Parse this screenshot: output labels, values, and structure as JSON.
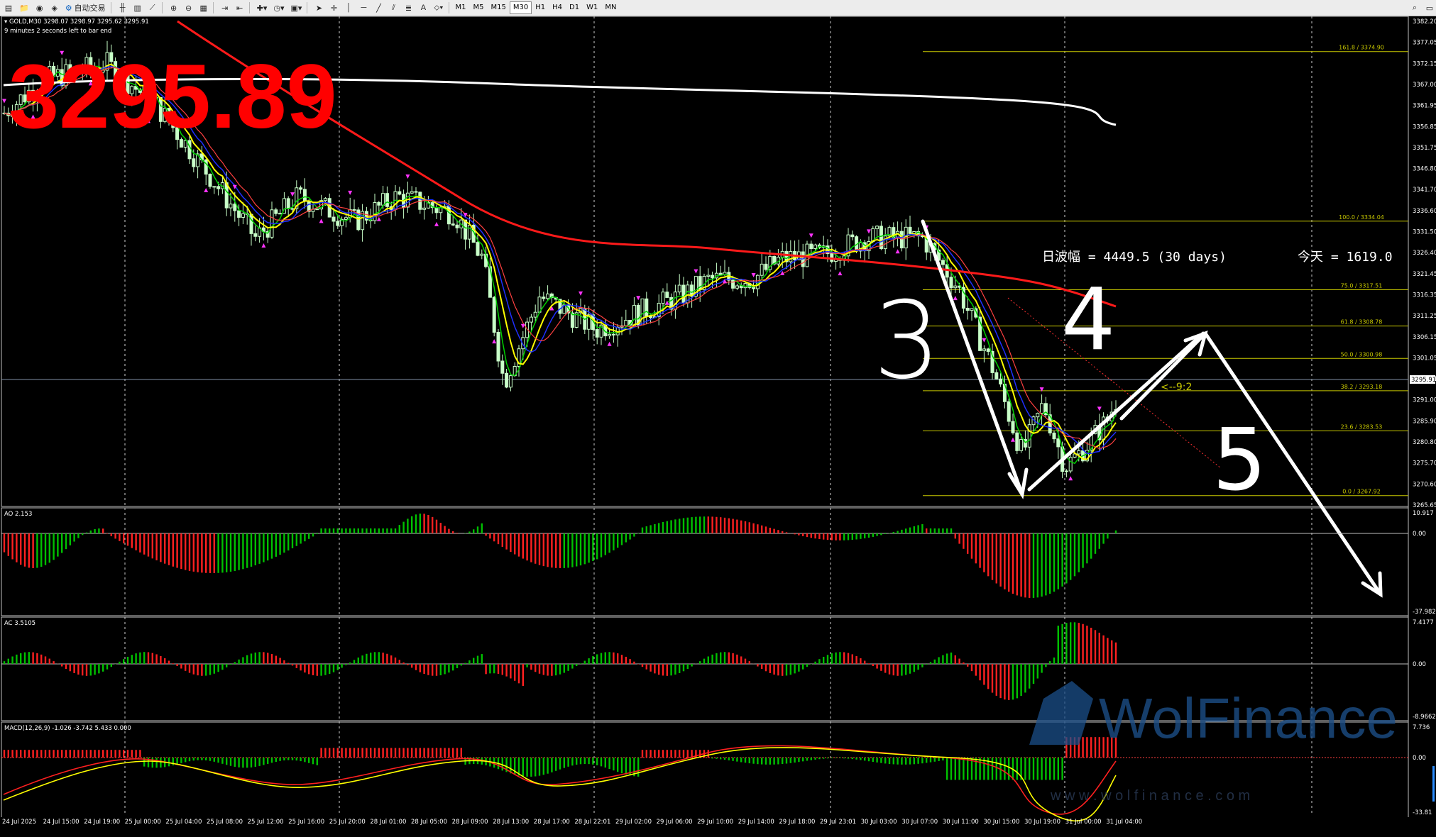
{
  "toolbar": {
    "auto_trade_label": "自动交易",
    "timeframes": [
      "M1",
      "M5",
      "M15",
      "M30",
      "H1",
      "H4",
      "D1",
      "W1",
      "MN"
    ],
    "active_timeframe": "M30"
  },
  "chart": {
    "symbol_line": "GOLD,M30  3298.07 3298.97 3295.62 3295.91",
    "bar_end_text": "9 minutes 2 seconds left to bar end",
    "big_price": "3295.89",
    "current_price": "3295.91",
    "wave_info_left": "日波幅 = 4449.5  (30 days)",
    "wave_info_right": "今天 = 1619.0",
    "countdown_marker": "<--9:2",
    "handwritten_labels": [
      "3",
      "4",
      "5"
    ],
    "price_axis": [
      "3382.20",
      "3377.05",
      "3372.15",
      "3367.00",
      "3361.95",
      "3356.85",
      "3351.75",
      "3346.80",
      "3341.70",
      "3336.60",
      "3331.50",
      "3326.40",
      "3321.45",
      "3316.35",
      "3311.25",
      "3306.15",
      "3301.05",
      "3295.91",
      "3291.00",
      "3285.90",
      "3280.80",
      "3275.70",
      "3270.60",
      "3265.65"
    ],
    "fibonacci": [
      {
        "label": "161.8  /  3374.90",
        "level": 161.8
      },
      {
        "label": "100.0  /  3334.04",
        "level": 100.0
      },
      {
        "label": "75.0  /  3317.51",
        "level": 75.0
      },
      {
        "label": "61.8  /  3308.78",
        "level": 61.8
      },
      {
        "label": "50.0  /  3300.98",
        "level": 50.0
      },
      {
        "label": "38.2  /  3293.18",
        "level": 38.2
      },
      {
        "label": "23.6  /  3283.53",
        "level": 23.6
      },
      {
        "label": "0.0  /  3267.92",
        "level": 0.0
      }
    ],
    "time_axis": [
      "24 Jul 2025",
      "24 Jul 15:00",
      "24 Jul 19:00",
      "25 Jul 00:00",
      "25 Jul 04:00",
      "25 Jul 08:00",
      "25 Jul 12:00",
      "25 Jul 16:00",
      "25 Jul 20:00",
      "28 Jul 01:00",
      "28 Jul 05:00",
      "28 Jul 09:00",
      "28 Jul 13:00",
      "28 Jul 17:00",
      "28 Jul 22:01",
      "29 Jul 02:00",
      "29 Jul 06:00",
      "29 Jul 10:00",
      "29 Jul 14:00",
      "29 Jul 18:00",
      "29 Jul 23:01",
      "30 Jul 03:00",
      "30 Jul 07:00",
      "30 Jul 11:00",
      "30 Jul 15:00",
      "30 Jul 19:00",
      "31 Jul 00:00",
      "31 Jul 04:00"
    ]
  },
  "indicators": {
    "ao": {
      "label": "AO 2.153",
      "max": "10.917",
      "zero": "0.00",
      "min": "-37.982"
    },
    "ac": {
      "label": "AC 3.5105",
      "max": "7.4177",
      "zero": "0.00",
      "min": "-8.9662"
    },
    "macd": {
      "label": "MACD(12,26,9) -1.026 -3.742 5.433 0.000",
      "max": "7.736",
      "zero": "0.00",
      "min": "-33.81"
    }
  },
  "watermark": {
    "brand": "WolFinance",
    "url": "w w w . w o l f i n a n c e . c o m"
  },
  "colors": {
    "bull": "#00c000",
    "bear": "#ff2020",
    "candle": "#c8ffc8",
    "ma_red": "#ff1a1a",
    "ma_blue": "#1f2fff",
    "ma_yellow": "#ffff00",
    "ma_green": "#00d000",
    "fib": "#c8c800",
    "annot": "#ffffff",
    "price_red": "#ff0000",
    "fractal": "#ff33ff"
  }
}
